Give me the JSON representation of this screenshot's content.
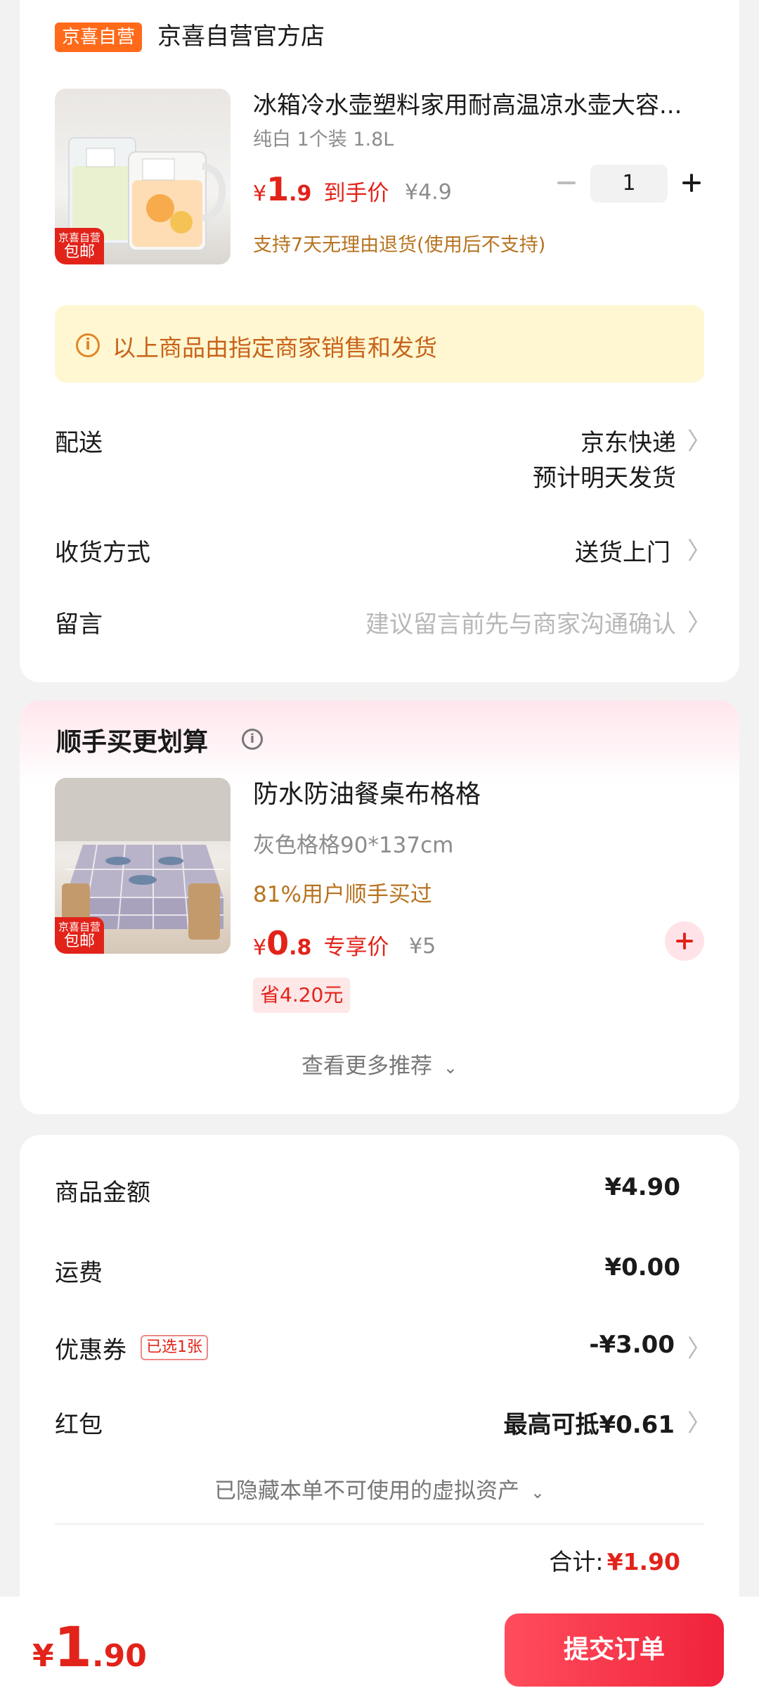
{
  "store": {
    "tag": "京喜自营",
    "name": "京喜自营官方店"
  },
  "product": {
    "title": "冰箱冷水壶塑料家用耐高温凉水壶大容...",
    "spec": "纯白 1个装 1.8L",
    "price_symbol": "¥",
    "price_int": "1",
    "price_dec": ".9",
    "price_label": "到手价",
    "orig_price": "¥4.9",
    "quantity": "1",
    "return_policy": "支持7天无理由退货(使用后不支持)",
    "ship_badge_line1": "京喜自营",
    "ship_badge_line2": "包邮"
  },
  "notice": {
    "text": "以上商品由指定商家销售和发货"
  },
  "delivery": {
    "label": "配送",
    "value1": "京东快递",
    "value2": "预计明天发货"
  },
  "receive": {
    "label": "收货方式",
    "value": "送货上门"
  },
  "message": {
    "label": "留言",
    "placeholder": "建议留言前先与商家沟通确认"
  },
  "recommend": {
    "title": "顺手买更划算",
    "product_title": "防水防油餐桌布格格",
    "spec": "灰色格格90*137cm",
    "social": "81%用户顺手买过",
    "price_symbol": "¥",
    "price_int": "0",
    "price_dec": ".8",
    "price_label": "专享价",
    "orig_price": "¥5",
    "save": "省4.20元",
    "more": "查看更多推荐",
    "ship_badge_line1": "京喜自营",
    "ship_badge_line2": "包邮"
  },
  "summary": {
    "goods_label": "商品金额",
    "goods_value": "¥4.90",
    "freight_label": "运费",
    "freight_value": "¥0.00",
    "coupon_label": "优惠券",
    "coupon_tag": "已选1张",
    "coupon_value": "-¥3.00",
    "redpack_label": "红包",
    "redpack_value": "最高可抵¥0.61",
    "hidden_assets": "已隐藏本单不可使用的虚拟资产",
    "total_label": "合计:",
    "total_value": "¥1.90"
  },
  "bottom": {
    "symbol": "¥",
    "int": "1",
    "dec": ".90",
    "submit": "提交订单"
  },
  "colors": {
    "accent_red": "#e2231a",
    "tag_orange": "#ff6a1a",
    "notice_bg": "#fff7d1",
    "gold_text": "#b7731f"
  }
}
